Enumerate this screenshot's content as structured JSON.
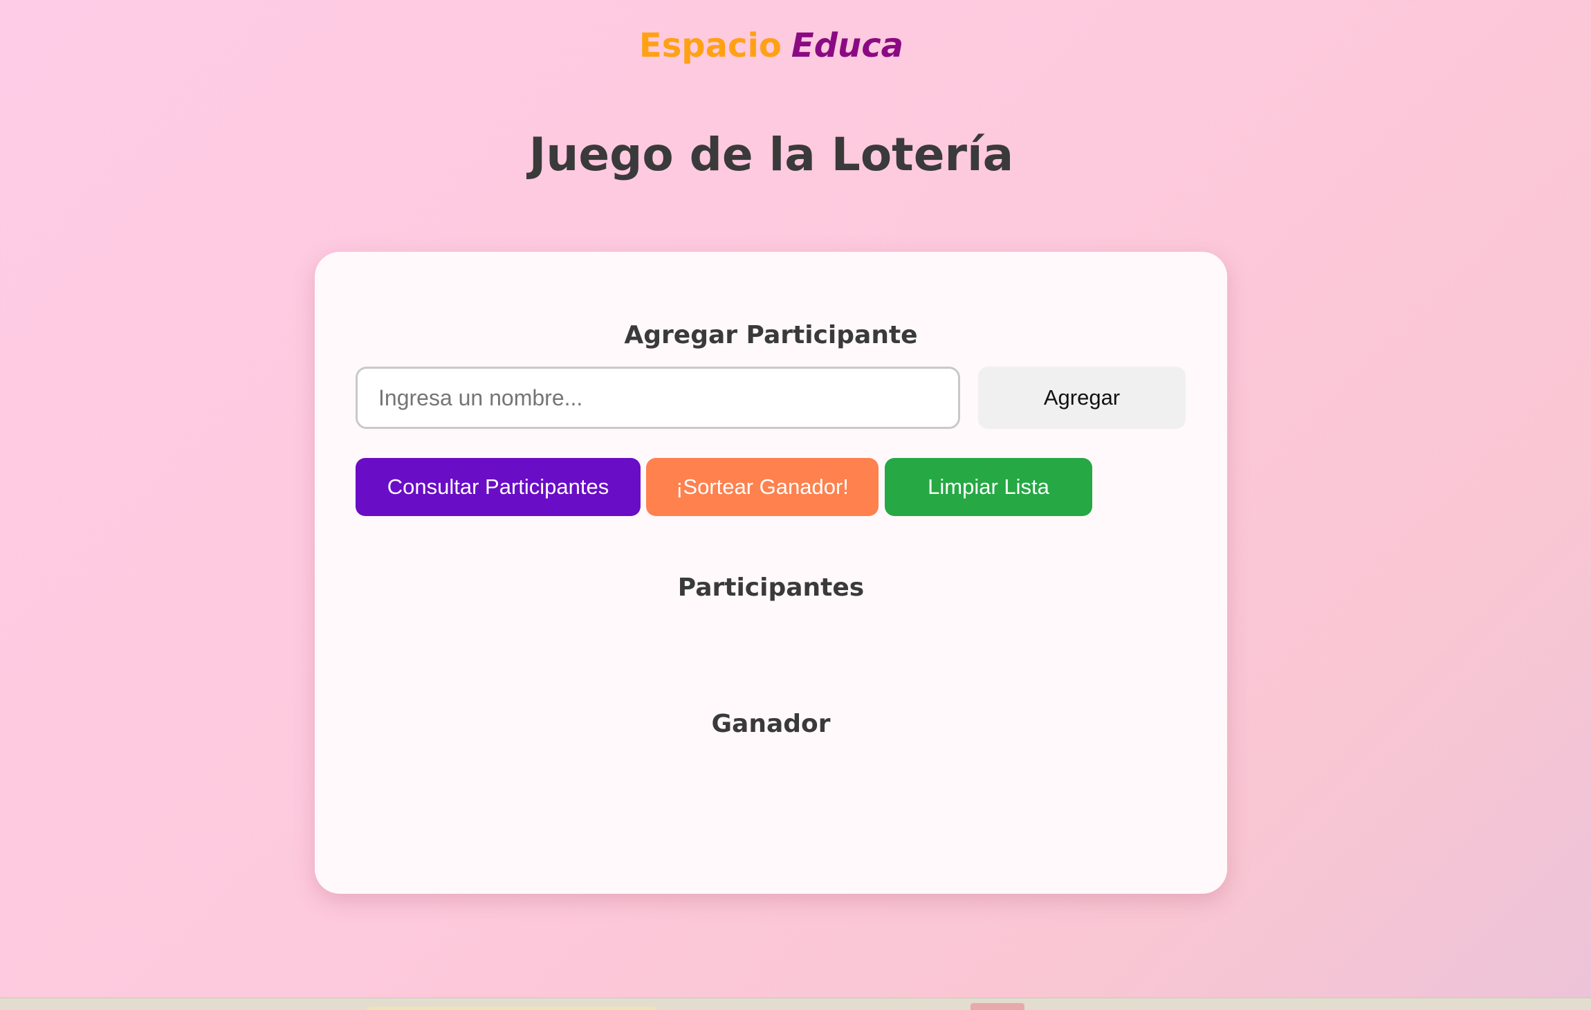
{
  "brand": {
    "part1": "Espacio",
    "part2": "Educa",
    "color1": "#ffa113",
    "color2": "#8b0a83"
  },
  "page": {
    "title": "Juego de la Lotería"
  },
  "add_section": {
    "title": "Agregar Participante",
    "input_placeholder": "Ingresa un nombre...",
    "input_value": "",
    "add_label": "Agregar"
  },
  "actions": {
    "list_label": "Consultar Participantes",
    "draw_label": "¡Sortear Ganador!",
    "clear_label": "Limpiar Lista",
    "list_color": "#6a0dc6",
    "draw_color": "#fe814e",
    "clear_color": "#26a844"
  },
  "participants": {
    "title": "Participantes",
    "items": []
  },
  "winner": {
    "title": "Ganador",
    "value": ""
  }
}
